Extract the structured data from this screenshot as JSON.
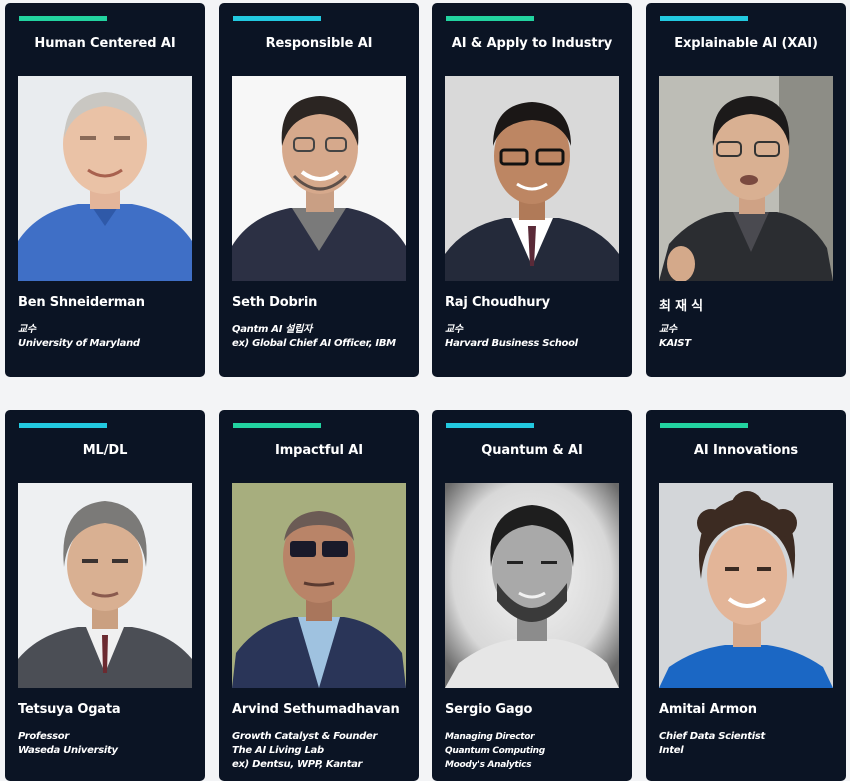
{
  "speakers": [
    {
      "topic": "Human Centered AI",
      "name": "Ben Shneiderman",
      "affiliation": [
        "교수",
        "University of Maryland"
      ],
      "accent": "#22d3a0"
    },
    {
      "topic": "Responsible AI",
      "name": "Seth Dobrin",
      "affiliation": [
        "Qantm AI 설립자",
        "ex) Global Chief AI Officer, IBM"
      ],
      "accent": "#22c9e0"
    },
    {
      "topic": "AI & Apply to Industry",
      "name": "Raj Choudhury",
      "affiliation": [
        "교수",
        "Harvard Business School"
      ],
      "accent": "#22d3a0"
    },
    {
      "topic": "Explainable AI (XAI)",
      "name": "최 재 식",
      "affiliation": [
        "교수",
        "KAIST"
      ],
      "accent": "#22c9e0"
    },
    {
      "topic": "ML/DL",
      "name": "Tetsuya Ogata",
      "affiliation": [
        "Professor",
        "Waseda University"
      ],
      "accent": "#22c9e0"
    },
    {
      "topic": "Impactful AI",
      "name": "Arvind Sethumadhavan",
      "affiliation": [
        "Growth Catalyst & Founder",
        "The AI Living Lab",
        "ex) Dentsu, WPP, Kantar"
      ],
      "accent": "#22d3a0"
    },
    {
      "topic": "Quantum & AI",
      "name": "Sergio Gago",
      "affiliation": [
        "Managing Director",
        "Quantum Computing",
        "Moody's Analytics"
      ],
      "accent": "#22c9e0"
    },
    {
      "topic": "AI Innovations",
      "name": "Amitai Armon",
      "affiliation": [
        "Chief Data Scientist",
        "Intel"
      ],
      "accent": "#22d3a0"
    }
  ]
}
